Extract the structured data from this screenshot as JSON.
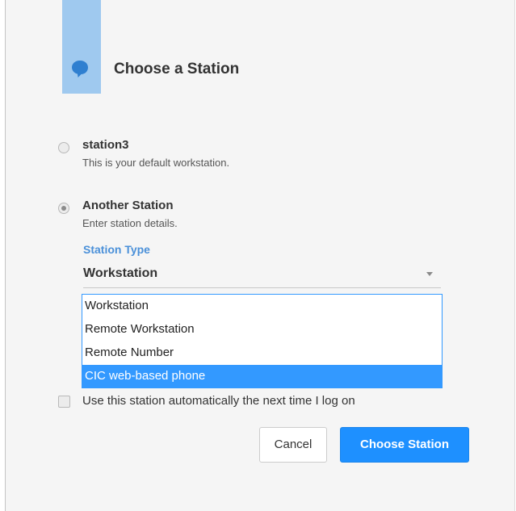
{
  "dialog": {
    "title": "Choose a Station",
    "icon": "chat-bubble-icon",
    "accent_color": "#9fc9ef"
  },
  "options": [
    {
      "title": "station3",
      "description": "This is your default workstation.",
      "selected": false
    },
    {
      "title": "Another Station",
      "description": "Enter station details.",
      "selected": true
    }
  ],
  "station_type": {
    "label": "Station Type",
    "selected_value": "Workstation",
    "dropdown_items": [
      {
        "label": "Workstation",
        "highlighted": false
      },
      {
        "label": "Remote Workstation",
        "highlighted": false
      },
      {
        "label": "Remote Number",
        "highlighted": false
      },
      {
        "label": "CIC web-based phone",
        "highlighted": true
      }
    ]
  },
  "auto_use": {
    "label": "Use this station automatically the next time I log on",
    "checked": false
  },
  "buttons": {
    "cancel": "Cancel",
    "choose": "Choose Station",
    "primary_color": "#1e90ff"
  }
}
